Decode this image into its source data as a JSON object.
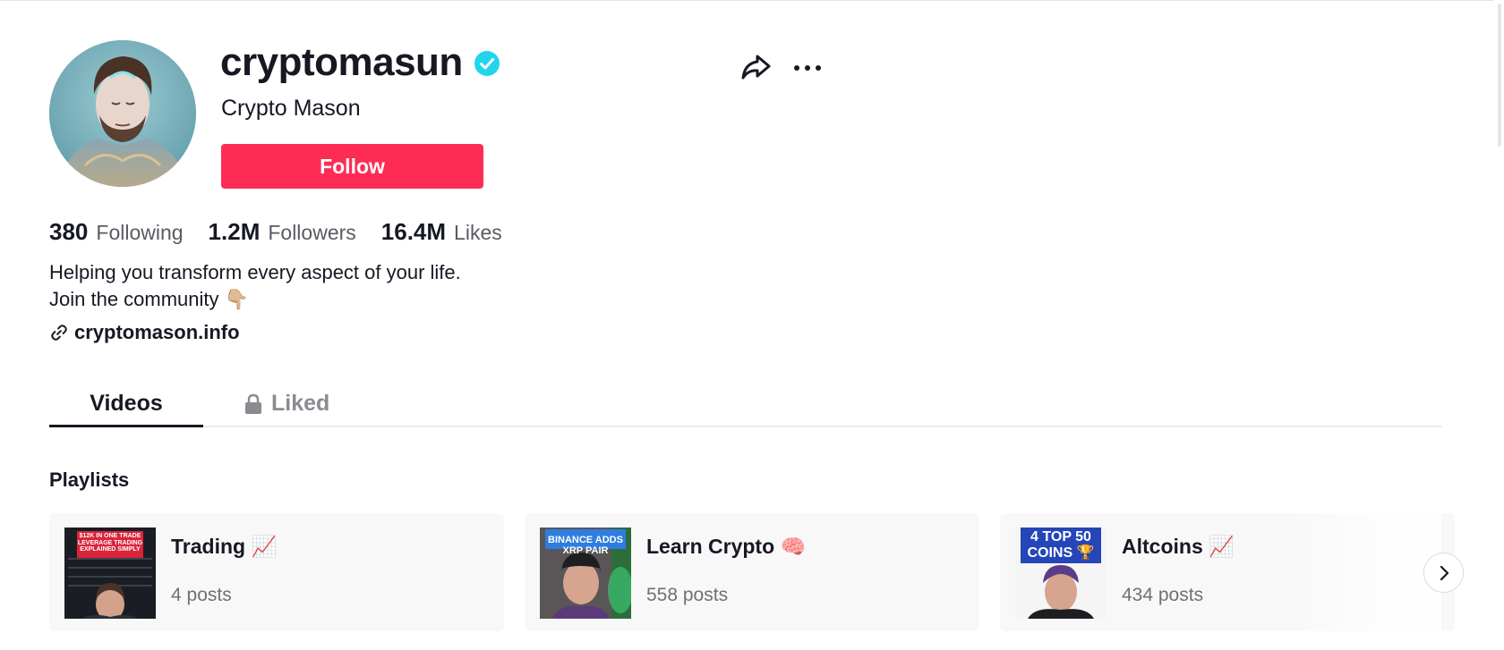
{
  "profile": {
    "username": "cryptomasun",
    "nickname": "Crypto Mason",
    "follow_label": "Follow",
    "verified_icon": "verified-badge-icon",
    "share_icon": "share-arrow-icon",
    "more_icon": "more-horizontal-icon"
  },
  "stats": [
    {
      "value": "380",
      "label": "Following"
    },
    {
      "value": "1.2M",
      "label": "Followers"
    },
    {
      "value": "16.4M",
      "label": "Likes"
    }
  ],
  "bio": {
    "line1": "Helping you transform every aspect of your life.",
    "line2": "Join the community 👇🏼"
  },
  "link": {
    "text": "cryptomason.info",
    "icon": "link-icon"
  },
  "tabs": [
    {
      "label": "Videos",
      "active": true
    },
    {
      "label": "Liked",
      "locked": true,
      "icon": "lock-icon"
    }
  ],
  "playlists": {
    "title": "Playlists",
    "items": [
      {
        "title": "Trading 📈",
        "count": "4 posts",
        "thumb_text": "$12K IN ONE TRADE LEVERAGE TRADING EXPLAINED SIMPLY"
      },
      {
        "title": "Learn Crypto 🧠",
        "count": "558 posts",
        "thumb_text": "BINANCE ADDS XRP PAIR"
      },
      {
        "title": "Altcoins 📈",
        "count": "434 posts",
        "thumb_text": "4 TOP 50 COINS 🏆"
      }
    ],
    "next_icon": "chevron-right-icon"
  },
  "colors": {
    "accent": "#fe2c55",
    "verified": "#20d5ec",
    "text": "#161823",
    "muted": "#5a5b62"
  }
}
